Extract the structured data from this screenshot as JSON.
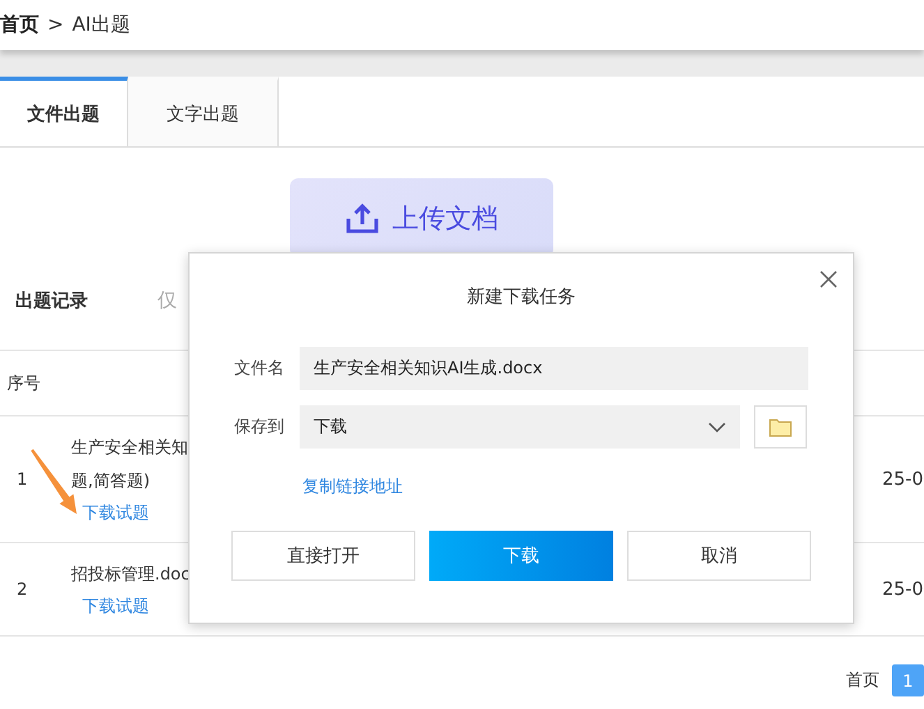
{
  "breadcrumb": {
    "home": "首页",
    "separator": ">",
    "current": "AI出题"
  },
  "tabs": [
    {
      "label": "文件出题",
      "selected": true
    },
    {
      "label": "文字出题",
      "selected": false
    }
  ],
  "upload_button": {
    "label": "上传文档"
  },
  "records": {
    "title": "出题记录",
    "note": "仅"
  },
  "table": {
    "columns": [
      "序号"
    ],
    "rows": [
      {
        "index": "1",
        "title_lines": [
          "生产安全相关知",
          "题,简答题)"
        ],
        "action": "下载试题",
        "date": "25-0"
      },
      {
        "index": "2",
        "title_lines": [
          "招投标管理.doc"
        ],
        "action": "下载试题",
        "date": "25-0"
      }
    ]
  },
  "pagination": {
    "first": "首页",
    "pages": [
      {
        "label": "1",
        "selected": true
      }
    ]
  },
  "dialog": {
    "title": "新建下载任务",
    "filename_label": "文件名",
    "filename": "生产安全相关知识AI生成.docx",
    "save_label": "保存到",
    "save_to": "下载",
    "copy_link": "复制链接地址",
    "buttons": [
      {
        "label": "直接打开",
        "kind": "secondary"
      },
      {
        "label": "下载",
        "kind": "primary"
      },
      {
        "label": "取消",
        "kind": "secondary"
      }
    ]
  }
}
